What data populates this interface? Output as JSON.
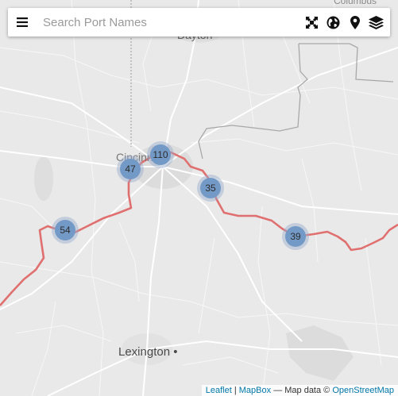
{
  "search": {
    "placeholder": "Search Port Names"
  },
  "toolbar": {
    "icons": [
      "menu-icon",
      "fullscreen-icon",
      "globe-icon",
      "map-pin-icon",
      "layers-icon"
    ]
  },
  "map": {
    "cities": {
      "dayton": "Dayton",
      "cincinnati": "Cincinnati",
      "lexington": "Lexington",
      "columbus": "Columbus"
    },
    "clusters": [
      {
        "label": "110"
      },
      {
        "label": "47"
      },
      {
        "label": "35"
      },
      {
        "label": "54"
      },
      {
        "label": "39"
      }
    ],
    "river_color": "#e07070",
    "cluster_color": "#7399c6"
  },
  "attribution": {
    "leaflet": "Leaflet",
    "sep": "|",
    "mapbox": "MapBox",
    "data_prefix": "— Map data ©",
    "osm": "OpenStreetMap"
  }
}
